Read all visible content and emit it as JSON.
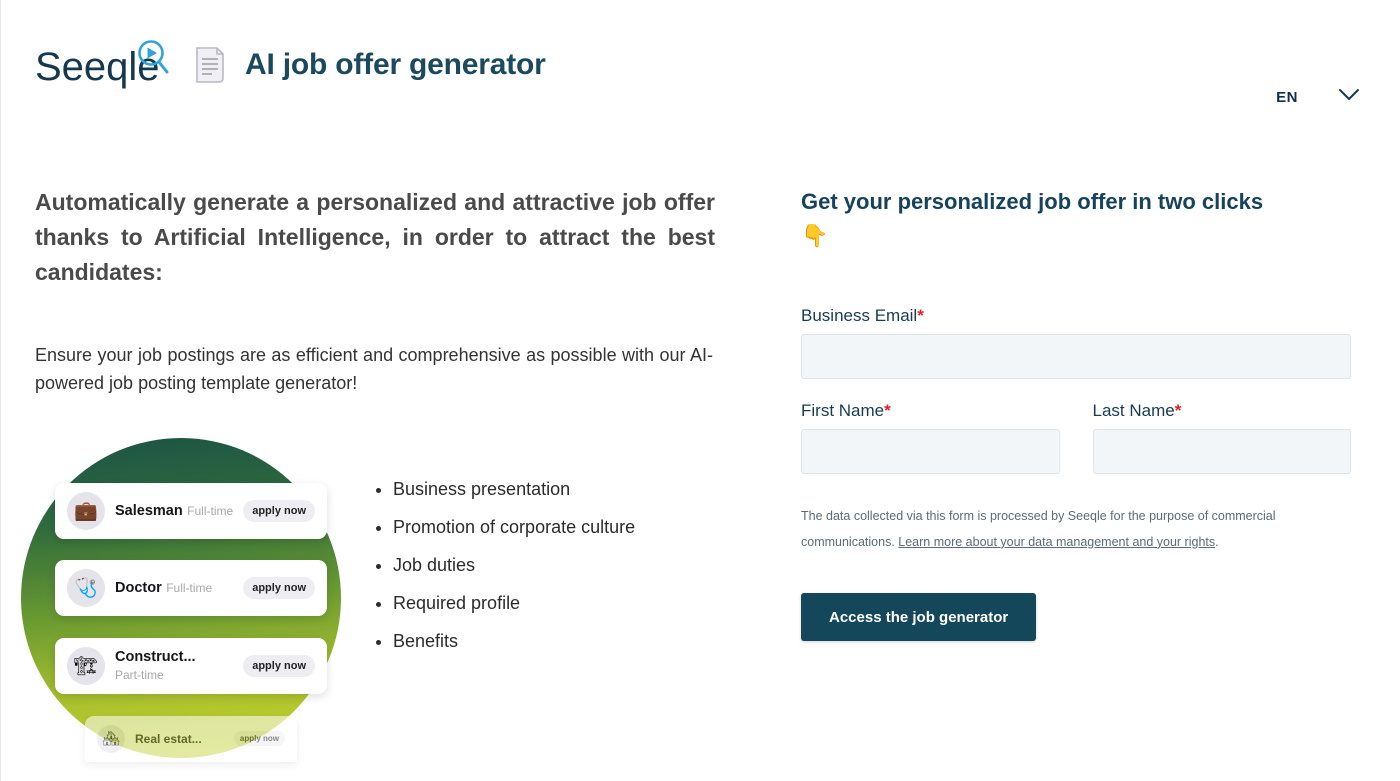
{
  "header": {
    "brand_name": "Seeqle",
    "brand_icon": "magnifier-play-icon",
    "doc_icon": "page-document-icon",
    "app_title": "AI job offer generator",
    "language": {
      "code": "EN",
      "chevron_icon": "chevron-down-icon"
    },
    "colors": {
      "brand_navy": "#14384e",
      "logo_blue": "#2ea3dd",
      "title": "#1b4a5e"
    }
  },
  "left": {
    "headline": "Automatically generate a personalized and attractive job offer thanks to Artificial Intelligence, in order to attract the best candidates:",
    "lede": "Ensure your job postings are as efficient and comprehensive as possible with our AI-powered job posting template generator!",
    "illustration": {
      "gradient_from": "#1b5247",
      "gradient_to": "#c9d42b",
      "cards": [
        {
          "icon": "briefcase-icon",
          "glyph": "💼",
          "title": "Salesman",
          "subtitle": "Full-time",
          "apply_label": "apply now"
        },
        {
          "icon": "stethoscope-icon",
          "glyph": "🩺",
          "title": "Doctor",
          "subtitle": "Full-time",
          "apply_label": "apply now"
        },
        {
          "icon": "crane-icon",
          "glyph": "🏗",
          "title": "Construct...",
          "subtitle": "Part-time",
          "apply_label": "apply now"
        },
        {
          "icon": "house-icon",
          "glyph": "🏘",
          "title": "Real estat...",
          "subtitle": "",
          "apply_label": "apply now"
        }
      ]
    },
    "bullets": [
      "Business presentation",
      "Promotion of corporate culture",
      "Job duties",
      "Required profile",
      "Benefits"
    ]
  },
  "form": {
    "title_text": "Get your personalized job offer in two clicks ",
    "title_emoji": "👇",
    "fields": {
      "email": {
        "label": "Business Email",
        "required_mark": "*",
        "value": "",
        "placeholder": ""
      },
      "first_name": {
        "label": "First Name",
        "required_mark": "*",
        "value": "",
        "placeholder": ""
      },
      "last_name": {
        "label": "Last Name",
        "required_mark": "*",
        "value": "",
        "placeholder": ""
      }
    },
    "privacy_text": "The data collected via this form is processed by Seeqle for the purpose of commercial communications. ",
    "privacy_link": "Learn more about your data management and your rights",
    "privacy_tail": ".",
    "submit_label": "Access the job generator",
    "submit_color": "#15475a"
  }
}
